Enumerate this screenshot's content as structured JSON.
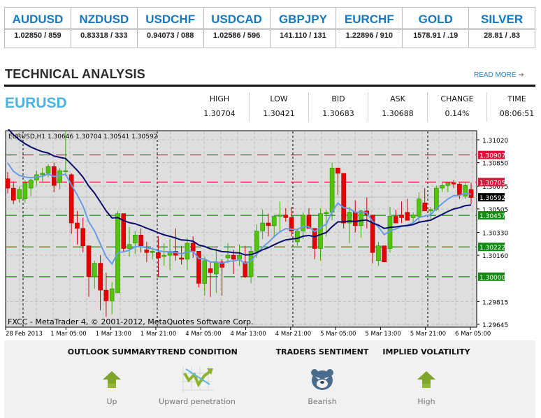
{
  "ticker": [
    {
      "symbol": "AUDUSD",
      "price": "1.02850 / 859"
    },
    {
      "symbol": "NZDUSD",
      "price": "0.83318 / 333"
    },
    {
      "symbol": "USDCHF",
      "price": "0.94073 / 088"
    },
    {
      "symbol": "USDCAD",
      "price": "1.02586 / 596"
    },
    {
      "symbol": "GBPJPY",
      "price": "141.110 / 131"
    },
    {
      "symbol": "EURCHF",
      "price": "1.22896 / 910"
    },
    {
      "symbol": "GOLD",
      "price": "1578.91 / .19"
    },
    {
      "symbol": "SILVER",
      "price": "28.81 / .83"
    }
  ],
  "section": {
    "title": "TECHNICAL ANALYSIS",
    "read_more": "READ MORE",
    "read_more_icon": "arrow-right-icon"
  },
  "instrument": {
    "pair": "EURUSD",
    "stats": [
      {
        "label": "HIGH",
        "value": "1.30704"
      },
      {
        "label": "LOW",
        "value": "1.30421"
      },
      {
        "label": "BID",
        "value": "1.30683"
      },
      {
        "label": "ASK",
        "value": "1.30688"
      },
      {
        "label": "CHANGE",
        "value": "0.14%"
      },
      {
        "label": "TIME",
        "value": "08:06:51"
      }
    ]
  },
  "chart_data": {
    "type": "candlestick",
    "title": "EURUSD,H1  1.30646 1.30704 1.30541 1.30592",
    "watermark": "FXCC - MetaTrader 4, © 2001-2012, MetaQuotes Software Corp.",
    "ylim": [
      1.29645,
      1.3102
    ],
    "y_ticks": [
      "1.31020",
      "1.30850",
      "1.30675",
      "1.30505",
      "1.30330",
      "1.30160",
      "1.29815",
      "1.29645"
    ],
    "x_ticks": [
      "28 Feb 2013",
      "1 Mar 05:00",
      "1 Mar 13:00",
      "1 Mar 21:00",
      "4 Mar 05:00",
      "4 Mar 13:00",
      "4 Mar 21:00",
      "5 Mar 05:00",
      "5 Mar 13:00",
      "5 Mar 21:00",
      "6 Mar 05:00"
    ],
    "current_price": "1.30592",
    "levels": [
      {
        "price": 1.30907,
        "label": "1.30907",
        "type": "resistance",
        "color": "#dc143c"
      },
      {
        "price": 1.30705,
        "label": "1.30705",
        "type": "resistance",
        "color": "#dc143c"
      },
      {
        "price": 1.30457,
        "label": "1.30457",
        "type": "support",
        "color": "#138a13"
      },
      {
        "price": 1.30222,
        "label": "1.30222",
        "type": "support",
        "color": "#138a13"
      },
      {
        "price": 1.3,
        "label": "1.30000",
        "type": "support",
        "color": "#138a13"
      }
    ],
    "candles": [
      [
        1.3073,
        1.3078,
        1.3062,
        1.3066
      ],
      [
        1.3066,
        1.3071,
        1.3054,
        1.3057
      ],
      [
        1.3058,
        1.3067,
        1.3055,
        1.3065
      ],
      [
        1.3058,
        1.3072,
        1.3055,
        1.307
      ],
      [
        1.3066,
        1.3073,
        1.306,
        1.3072
      ],
      [
        1.3072,
        1.3079,
        1.3068,
        1.3076
      ],
      [
        1.3076,
        1.3081,
        1.307,
        1.3077
      ],
      [
        1.3077,
        1.3084,
        1.3074,
        1.3082
      ],
      [
        1.3082,
        1.3085,
        1.3063,
        1.3068
      ],
      [
        1.307,
        1.3081,
        1.3065,
        1.3079
      ],
      [
        1.3079,
        1.3109,
        1.3075,
        1.3079
      ],
      [
        1.3076,
        1.3077,
        1.3032,
        1.304
      ],
      [
        1.304,
        1.3049,
        1.3024,
        1.3036
      ],
      [
        1.3036,
        1.3044,
        1.3018,
        1.3023
      ],
      [
        1.3023,
        1.3023,
        1.2985,
        1.3
      ],
      [
        1.3,
        1.3012,
        1.2991,
        1.301
      ],
      [
        1.301,
        1.3016,
        1.2975,
        1.299
      ],
      [
        1.299,
        1.3003,
        1.297,
        1.2982
      ],
      [
        1.2982,
        1.2996,
        1.2972,
        1.2991
      ],
      [
        1.2988,
        1.3049,
        1.2988,
        1.3047
      ],
      [
        1.3047,
        1.3047,
        1.3018,
        1.3021
      ],
      [
        1.3021,
        1.3037,
        1.3015,
        1.3024
      ],
      [
        1.3025,
        1.3034,
        1.3017,
        1.3031
      ],
      [
        1.3031,
        1.3036,
        1.3018,
        1.3023
      ],
      [
        1.302,
        1.3026,
        1.3011,
        1.3018
      ],
      [
        1.3018,
        1.3022,
        1.3013,
        1.3019
      ],
      [
        1.3018,
        1.303,
        1.3,
        1.3014
      ],
      [
        1.3015,
        1.3025,
        1.3008,
        1.3016
      ],
      [
        1.3016,
        1.3028,
        1.3005,
        1.3019
      ],
      [
        1.3019,
        1.3036,
        1.3012,
        1.3016
      ],
      [
        1.3014,
        1.3023,
        1.3009,
        1.3013
      ],
      [
        1.3013,
        1.3029,
        1.3005,
        1.3025
      ],
      [
        1.3025,
        1.303,
        1.3014,
        1.3019
      ],
      [
        1.3019,
        1.3019,
        1.2992,
        1.2995
      ],
      [
        1.2995,
        1.3015,
        1.2986,
        1.3012
      ],
      [
        1.3006,
        1.3011,
        1.2985,
        1.3003
      ],
      [
        1.3002,
        1.3021,
        1.2988,
        1.3011
      ],
      [
        1.3011,
        1.3013,
        1.2986,
        1.3007
      ],
      [
        1.3014,
        1.3025,
        1.301,
        1.3016
      ],
      [
        1.3016,
        1.302,
        1.3002,
        1.3013
      ],
      [
        1.3013,
        1.3024,
        1.3008,
        1.3016
      ],
      [
        1.3011,
        1.3023,
        1.2999,
        1.3
      ],
      [
        1.3,
        1.3022,
        1.2995,
        1.3019
      ],
      [
        1.3019,
        1.3039,
        1.3014,
        1.3034
      ],
      [
        1.3034,
        1.305,
        1.3028,
        1.304
      ],
      [
        1.304,
        1.3047,
        1.303,
        1.3038
      ],
      [
        1.3038,
        1.3046,
        1.3029,
        1.3045
      ],
      [
        1.3045,
        1.3056,
        1.3034,
        1.3046
      ],
      [
        1.3046,
        1.3051,
        1.3041,
        1.3044
      ],
      [
        1.3044,
        1.3052,
        1.303,
        1.3034
      ],
      [
        1.3026,
        1.3036,
        1.3023,
        1.3034
      ],
      [
        1.3034,
        1.3048,
        1.3028,
        1.3046
      ],
      [
        1.3046,
        1.3051,
        1.3037,
        1.3036
      ],
      [
        1.3036,
        1.3036,
        1.3013,
        1.3021
      ],
      [
        1.3021,
        1.3051,
        1.3012,
        1.3047
      ],
      [
        1.3047,
        1.305,
        1.303,
        1.3048
      ],
      [
        1.3048,
        1.3085,
        1.3042,
        1.3081
      ],
      [
        1.3081,
        1.3074,
        1.3061,
        1.3077
      ],
      [
        1.3077,
        1.3075,
        1.3036,
        1.304
      ],
      [
        1.304,
        1.3052,
        1.3025,
        1.3048
      ],
      [
        1.3048,
        1.3057,
        1.3033,
        1.3038
      ],
      [
        1.3038,
        1.305,
        1.3029,
        1.3049
      ],
      [
        1.3049,
        1.3059,
        1.3036,
        1.3046
      ],
      [
        1.3046,
        1.3046,
        1.301,
        1.3018
      ],
      [
        1.3012,
        1.3026,
        1.3008,
        1.3023
      ],
      [
        1.3023,
        1.3022,
        1.3024,
        1.3011
      ],
      [
        1.3021,
        1.3052,
        1.3018,
        1.3045
      ],
      [
        1.3045,
        1.305,
        1.3042,
        1.304
      ],
      [
        1.3046,
        1.3056,
        1.304,
        1.3044
      ],
      [
        1.3048,
        1.3058,
        1.3043,
        1.3042
      ],
      [
        1.3044,
        1.3048,
        1.3039,
        1.3046
      ],
      [
        1.3045,
        1.3063,
        1.304,
        1.3058
      ],
      [
        1.3055,
        1.3066,
        1.3051,
        1.3049
      ],
      [
        1.3049,
        1.3052,
        1.3043,
        1.305
      ],
      [
        1.305,
        1.3068,
        1.3049,
        1.3066
      ],
      [
        1.3066,
        1.307,
        1.3063,
        1.3068
      ],
      [
        1.3068,
        1.307,
        1.3063,
        1.307
      ],
      [
        1.307,
        1.3072,
        1.3066,
        1.3069
      ],
      [
        1.3069,
        1.307,
        1.3058,
        1.3061
      ],
      [
        1.306,
        1.307,
        1.3058,
        1.3068
      ],
      [
        1.3065,
        1.307,
        1.3054,
        1.3059
      ]
    ],
    "ma_fast_color": "#6a9be8",
    "ma_slow_color": "#0b0b6e"
  },
  "summary": [
    {
      "heading": "OUTLOOK SUMMARY",
      "icon": "arrow-up-icon",
      "value": "Up"
    },
    {
      "heading": "TREND CONDITION",
      "icon": "trend-chart-icon",
      "value": "Upward penetration"
    },
    {
      "heading": "TRADERS SENTIMENT",
      "icon": "bear-icon",
      "value": "Bearish"
    },
    {
      "heading": "IMPLIED VOLATILITY",
      "icon": "arrow-up-icon",
      "value": "High"
    }
  ]
}
